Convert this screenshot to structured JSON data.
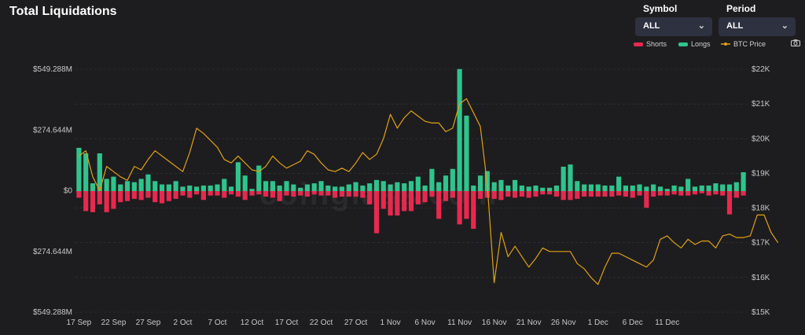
{
  "header": {
    "title": "Total Liquidations"
  },
  "controls": {
    "symbol": {
      "label": "Symbol",
      "value": "ALL"
    },
    "period": {
      "label": "Period",
      "value": "ALL"
    }
  },
  "watermark": "coinglass.com",
  "colors": {
    "shorts": "#e8294f",
    "longs": "#2fc48d",
    "btc": "#e1a10f",
    "background": "#1d1d1f",
    "grid": "#3a3a3a"
  },
  "chart_data": {
    "type": "bar",
    "title": "Total Liquidations",
    "legend": {
      "position": "top-right",
      "entries": [
        "Shorts",
        "Longs",
        "BTC Price"
      ]
    },
    "grid": true,
    "left_axis": {
      "ticks": [
        "$549.288M",
        "$274.644M",
        "$0",
        "$274.644M",
        "$549.288M"
      ],
      "range": [
        -549.288,
        549.288
      ],
      "unit": "M USD"
    },
    "right_axis": {
      "ticks": [
        "$22K",
        "$21K",
        "$20K",
        "$19K",
        "$18K",
        "$17K",
        "$16K",
        "$15K"
      ],
      "range": [
        15000,
        22000
      ]
    },
    "x_ticks": [
      "17 Sep",
      "22 Sep",
      "27 Sep",
      "2 Oct",
      "7 Oct",
      "12 Oct",
      "17 Oct",
      "22 Oct",
      "27 Oct",
      "1 Nov",
      "6 Nov",
      "11 Nov",
      "16 Nov",
      "21 Nov",
      "26 Nov",
      "1 Dec",
      "6 Dec",
      "11 Dec"
    ],
    "x_start": "2022-09-17",
    "series": [
      {
        "name": "Longs",
        "values": [
          195,
          170,
          35,
          170,
          55,
          65,
          30,
          45,
          40,
          55,
          75,
          45,
          30,
          30,
          45,
          20,
          25,
          20,
          25,
          25,
          30,
          55,
          20,
          130,
          70,
          10,
          115,
          45,
          45,
          25,
          45,
          30,
          15,
          30,
          35,
          45,
          25,
          20,
          20,
          30,
          40,
          25,
          35,
          50,
          45,
          30,
          40,
          35,
          45,
          65,
          25,
          100,
          40,
          70,
          100,
          550,
          340,
          25,
          70,
          90,
          40,
          50,
          25,
          50,
          25,
          20,
          25,
          15,
          15,
          25,
          110,
          120,
          45,
          30,
          30,
          30,
          25,
          25,
          65,
          25,
          25,
          30,
          20,
          30,
          20,
          10,
          25,
          20,
          55,
          20,
          25,
          25,
          35,
          30,
          30,
          40,
          85
        ]
      },
      {
        "name": "Shorts",
        "values": [
          -30,
          -90,
          -95,
          -60,
          -95,
          -80,
          -50,
          -45,
          -35,
          -40,
          -30,
          -50,
          -55,
          -45,
          -35,
          -20,
          -30,
          -15,
          -40,
          -20,
          -20,
          -30,
          -15,
          -25,
          -40,
          -20,
          -15,
          -25,
          -30,
          -45,
          -20,
          -25,
          -20,
          -25,
          -15,
          -20,
          -20,
          -30,
          -25,
          -25,
          -25,
          -30,
          -60,
          -190,
          -80,
          -110,
          -110,
          -90,
          -90,
          -60,
          -50,
          -25,
          -125,
          -45,
          -30,
          -150,
          -125,
          -170,
          -35,
          -30,
          -35,
          -40,
          -25,
          -30,
          -25,
          -30,
          -25,
          -15,
          -15,
          -25,
          -40,
          -40,
          -35,
          -25,
          -25,
          -25,
          -25,
          -25,
          -20,
          -25,
          -30,
          -20,
          -75,
          -25,
          -20,
          -20,
          -15,
          -20,
          -20,
          -15,
          -10,
          -20,
          -15,
          -20,
          -105,
          -30,
          -20
        ]
      },
      {
        "name": "BTC Price",
        "values": [
          19500,
          19650,
          18900,
          18500,
          19200,
          19050,
          18900,
          18800,
          19200,
          19100,
          19400,
          19650,
          19500,
          19350,
          19200,
          19050,
          19600,
          20300,
          20150,
          19950,
          19750,
          19400,
          19300,
          19500,
          19300,
          19100,
          19050,
          19200,
          19500,
          19300,
          19150,
          19250,
          19350,
          19650,
          19550,
          19300,
          19100,
          19050,
          19150,
          19050,
          19300,
          19600,
          19400,
          19550,
          20000,
          20700,
          20300,
          20600,
          20800,
          20650,
          20500,
          20450,
          20450,
          20200,
          20300,
          21000,
          21150,
          20750,
          20350,
          18700,
          15850,
          17300,
          16600,
          16900,
          16600,
          16300,
          16550,
          16850,
          16750,
          16750,
          16750,
          16750,
          16400,
          16250,
          16000,
          15800,
          16300,
          16700,
          16700,
          16600,
          16500,
          16400,
          16300,
          16500,
          17100,
          17200,
          17000,
          16850,
          17100,
          16950,
          17050,
          17050,
          16850,
          17200,
          17250,
          17150,
          17150,
          17200,
          17800,
          17800,
          17300,
          17000
        ]
      }
    ]
  }
}
